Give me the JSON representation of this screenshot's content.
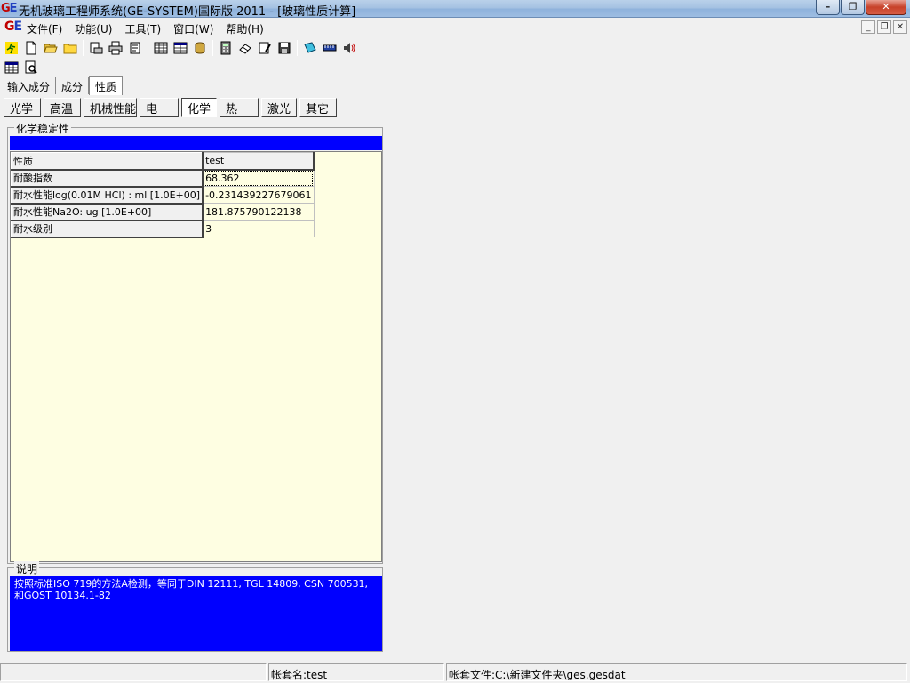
{
  "window": {
    "title": "无机玻璃工程师系统(GE-SYSTEM)国际版 2011 - [玻璃性质计算]",
    "app_logo": "GE"
  },
  "menu": [
    {
      "label": "文件(F)"
    },
    {
      "label": "功能(U)"
    },
    {
      "label": "工具(T)"
    },
    {
      "label": "窗口(W)"
    },
    {
      "label": "帮助(H)"
    }
  ],
  "tabs": [
    {
      "label": "输入成分",
      "active": false
    },
    {
      "label": "成分",
      "active": false
    },
    {
      "label": "性质",
      "active": true
    }
  ],
  "property_buttons": [
    {
      "label": "光学",
      "active": false
    },
    {
      "label": "高温",
      "active": false
    },
    {
      "label": "机械性能",
      "active": false
    },
    {
      "label": "电",
      "active": false
    },
    {
      "label": "化学",
      "active": true
    },
    {
      "label": "热",
      "active": false
    },
    {
      "label": "激光",
      "active": false
    },
    {
      "label": "其它",
      "active": false
    }
  ],
  "chemical_group": {
    "title": "化学稳定性",
    "header": {
      "label": "性质",
      "value": "test"
    },
    "rows": [
      {
        "label": "耐酸指数",
        "value": "68.362"
      },
      {
        "label": "耐水性能log(0.01M HCl) : ml [1.0E+00]",
        "value": "-0.231439227679061"
      },
      {
        "label": "耐水性能Na2O: ug [1.0E+00]",
        "value": "181.875790122138"
      },
      {
        "label": "耐水级别",
        "value": "3"
      }
    ]
  },
  "description": {
    "title": "说明",
    "text": "按照标准ISO 719的方法A检测，等同于DIN 12111, TGL 14809, CSN 700531, 和GOST 10134.1-82"
  },
  "statusbar": {
    "panel1": "",
    "account_name": "帐套名:test",
    "account_file": "帐套文件:C:\\新建文件夹\\ges.gesdat"
  },
  "colors": {
    "highlight_blue": "#0000ff",
    "grid_background": "#fefee2"
  }
}
